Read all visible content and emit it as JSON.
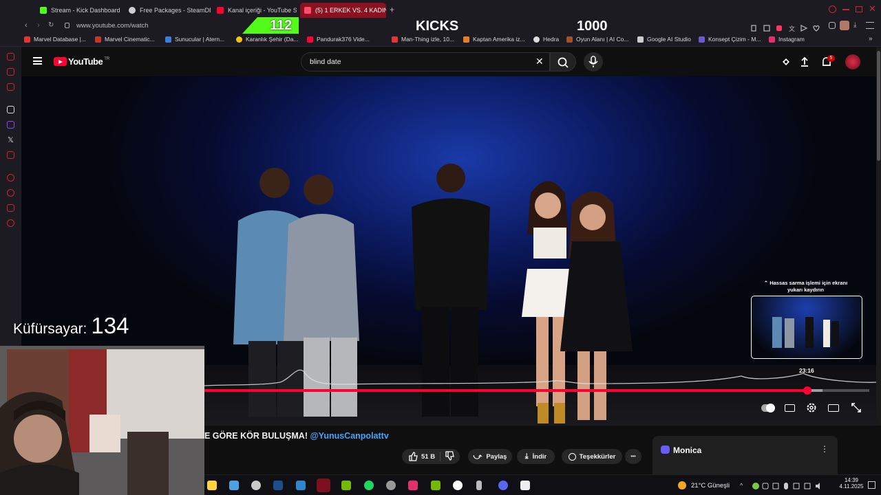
{
  "browser": {
    "tabs": [
      {
        "label": "Stream - Kick Dashboard",
        "color": "#53fc18"
      },
      {
        "label": "Free Packages - SteamDB",
        "color": "#d0d0d0"
      },
      {
        "label": "Kanal içeriği - YouTube St",
        "color": "#ff0033"
      },
      {
        "label": "(5) 1 ERKEK VS. 4 KADIN",
        "color": "#ff0033",
        "active": true
      }
    ],
    "new_tab": "+",
    "url": "www.youtube.com/watch",
    "bookmarks": [
      {
        "label": "Marvel Database |...",
        "color": "#e23636"
      },
      {
        "label": "Marvel Cinematic...",
        "color": "#c0392b"
      },
      {
        "label": "Sunucular | Atern...",
        "color": "#3b7dd8"
      },
      {
        "label": "Karanlık Şehir (Da...",
        "color": "#f1c40f"
      },
      {
        "label": "Pandurak376 Vide...",
        "color": "#ff0033"
      },
      {
        "label": "Man-Thing izle, 10...",
        "color": "#e23636"
      },
      {
        "label": "Kaptan Amerika iz...",
        "color": "#e67e22"
      },
      {
        "label": "Hedra",
        "color": "#dddddd"
      },
      {
        "label": "Oyun Alanı | AI Co...",
        "color": "#a0522d"
      },
      {
        "label": "Google AI Studio",
        "color": "#cccccc"
      },
      {
        "label": "Konsept Çizim - M...",
        "color": "#6a5acd"
      },
      {
        "label": "Instagram",
        "color": "#e1306c"
      }
    ]
  },
  "youtube": {
    "logo_text": "YouTube",
    "region": "TR",
    "search_value": "blind date",
    "notification_count": "5"
  },
  "overlays": {
    "kicks_left": "112",
    "kicks_label": "KICKS",
    "kicks_goal": "1000",
    "swear_label": "Küfürsayar:",
    "swear_count": "134"
  },
  "player": {
    "seek_hint": "Hassas sarma işlemi için ekranı yukarı kaydırın",
    "preview_time": "23:16",
    "progress": 0.907,
    "buffered": 0.93
  },
  "video": {
    "title_visible": "E GÖRE KÖR BULUŞMA!",
    "mention": "@YunusCanpolattv",
    "like_count": "51 B",
    "share_label": "Paylaş",
    "download_label": "İndir",
    "thanks_label": "Teşekkürler",
    "more_label": "•••"
  },
  "monica": {
    "label": "Monica"
  },
  "taskbar": {
    "weather": "21°C  Güneşli",
    "time": "14:39",
    "date": "4.11.2025"
  },
  "colors": {
    "accent": "#ff0033",
    "kick_green": "#53fc18",
    "active_tab": "#8b1020"
  }
}
